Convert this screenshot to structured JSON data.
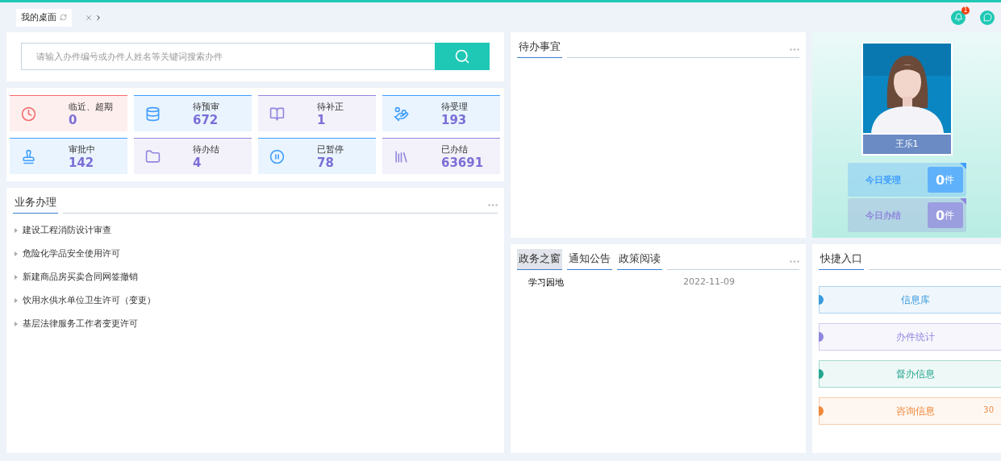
{
  "tabs": [
    {
      "label": "我的桌面",
      "selected": true
    }
  ],
  "notifications": {
    "badge": "1"
  },
  "search": {
    "placeholder": "请输入办件编号或办件人姓名等关键词搜索办件"
  },
  "stats": [
    {
      "kind": "clock",
      "label": "临近、超期",
      "value": "0",
      "color": "#f56c6c"
    },
    {
      "kind": "database",
      "label": "待预审",
      "value": "672",
      "color": "#409eff"
    },
    {
      "kind": "book",
      "label": "待补正",
      "value": "1",
      "color": "#8f86dd"
    },
    {
      "kind": "hand",
      "label": "待受理",
      "value": "193",
      "color": "#409eff"
    },
    {
      "kind": "stamp",
      "label": "审批中",
      "value": "142",
      "color": "#409eff"
    },
    {
      "kind": "folder",
      "label": "待办结",
      "value": "4",
      "color": "#8f86dd"
    },
    {
      "kind": "pause",
      "label": "已暂停",
      "value": "78",
      "color": "#409eff"
    },
    {
      "kind": "books",
      "label": "已办结",
      "value": "63691",
      "color": "#8f86dd"
    }
  ],
  "business": {
    "title": "业务办理",
    "items": [
      "建设工程消防设计审查",
      "危险化学品安全使用许可",
      "新建商品房买卖合同网签撤销",
      "饮用水供水单位卫生许可（变更）",
      "基层法律服务工作者变更许可"
    ]
  },
  "todo": {
    "title": "待办事宜"
  },
  "news": {
    "tabs": [
      {
        "label": "政务之窗",
        "selected": true
      },
      {
        "label": "通知公告",
        "selected": false
      },
      {
        "label": "政策阅读",
        "selected": false
      }
    ],
    "items": [
      {
        "title": "学习园地",
        "date": "2022-11-09"
      }
    ]
  },
  "profile": {
    "name": "王乐1",
    "today": [
      {
        "label": "今日受理",
        "value": "**0**件",
        "color": "#409eff"
      },
      {
        "label": "今日办结",
        "value": "**0**件",
        "color": "#8f86dd"
      }
    ]
  },
  "shortcuts": {
    "title": "快捷入口",
    "items": [
      {
        "label": "信息库",
        "color": "#3a9bdc"
      },
      {
        "label": "办件统计",
        "color": "#8f86dd"
      },
      {
        "label": "督办信息",
        "color": "#26a68f"
      },
      {
        "label": "咨询信息",
        "color": "#f0883a",
        "badge": "30"
      }
    ]
  }
}
